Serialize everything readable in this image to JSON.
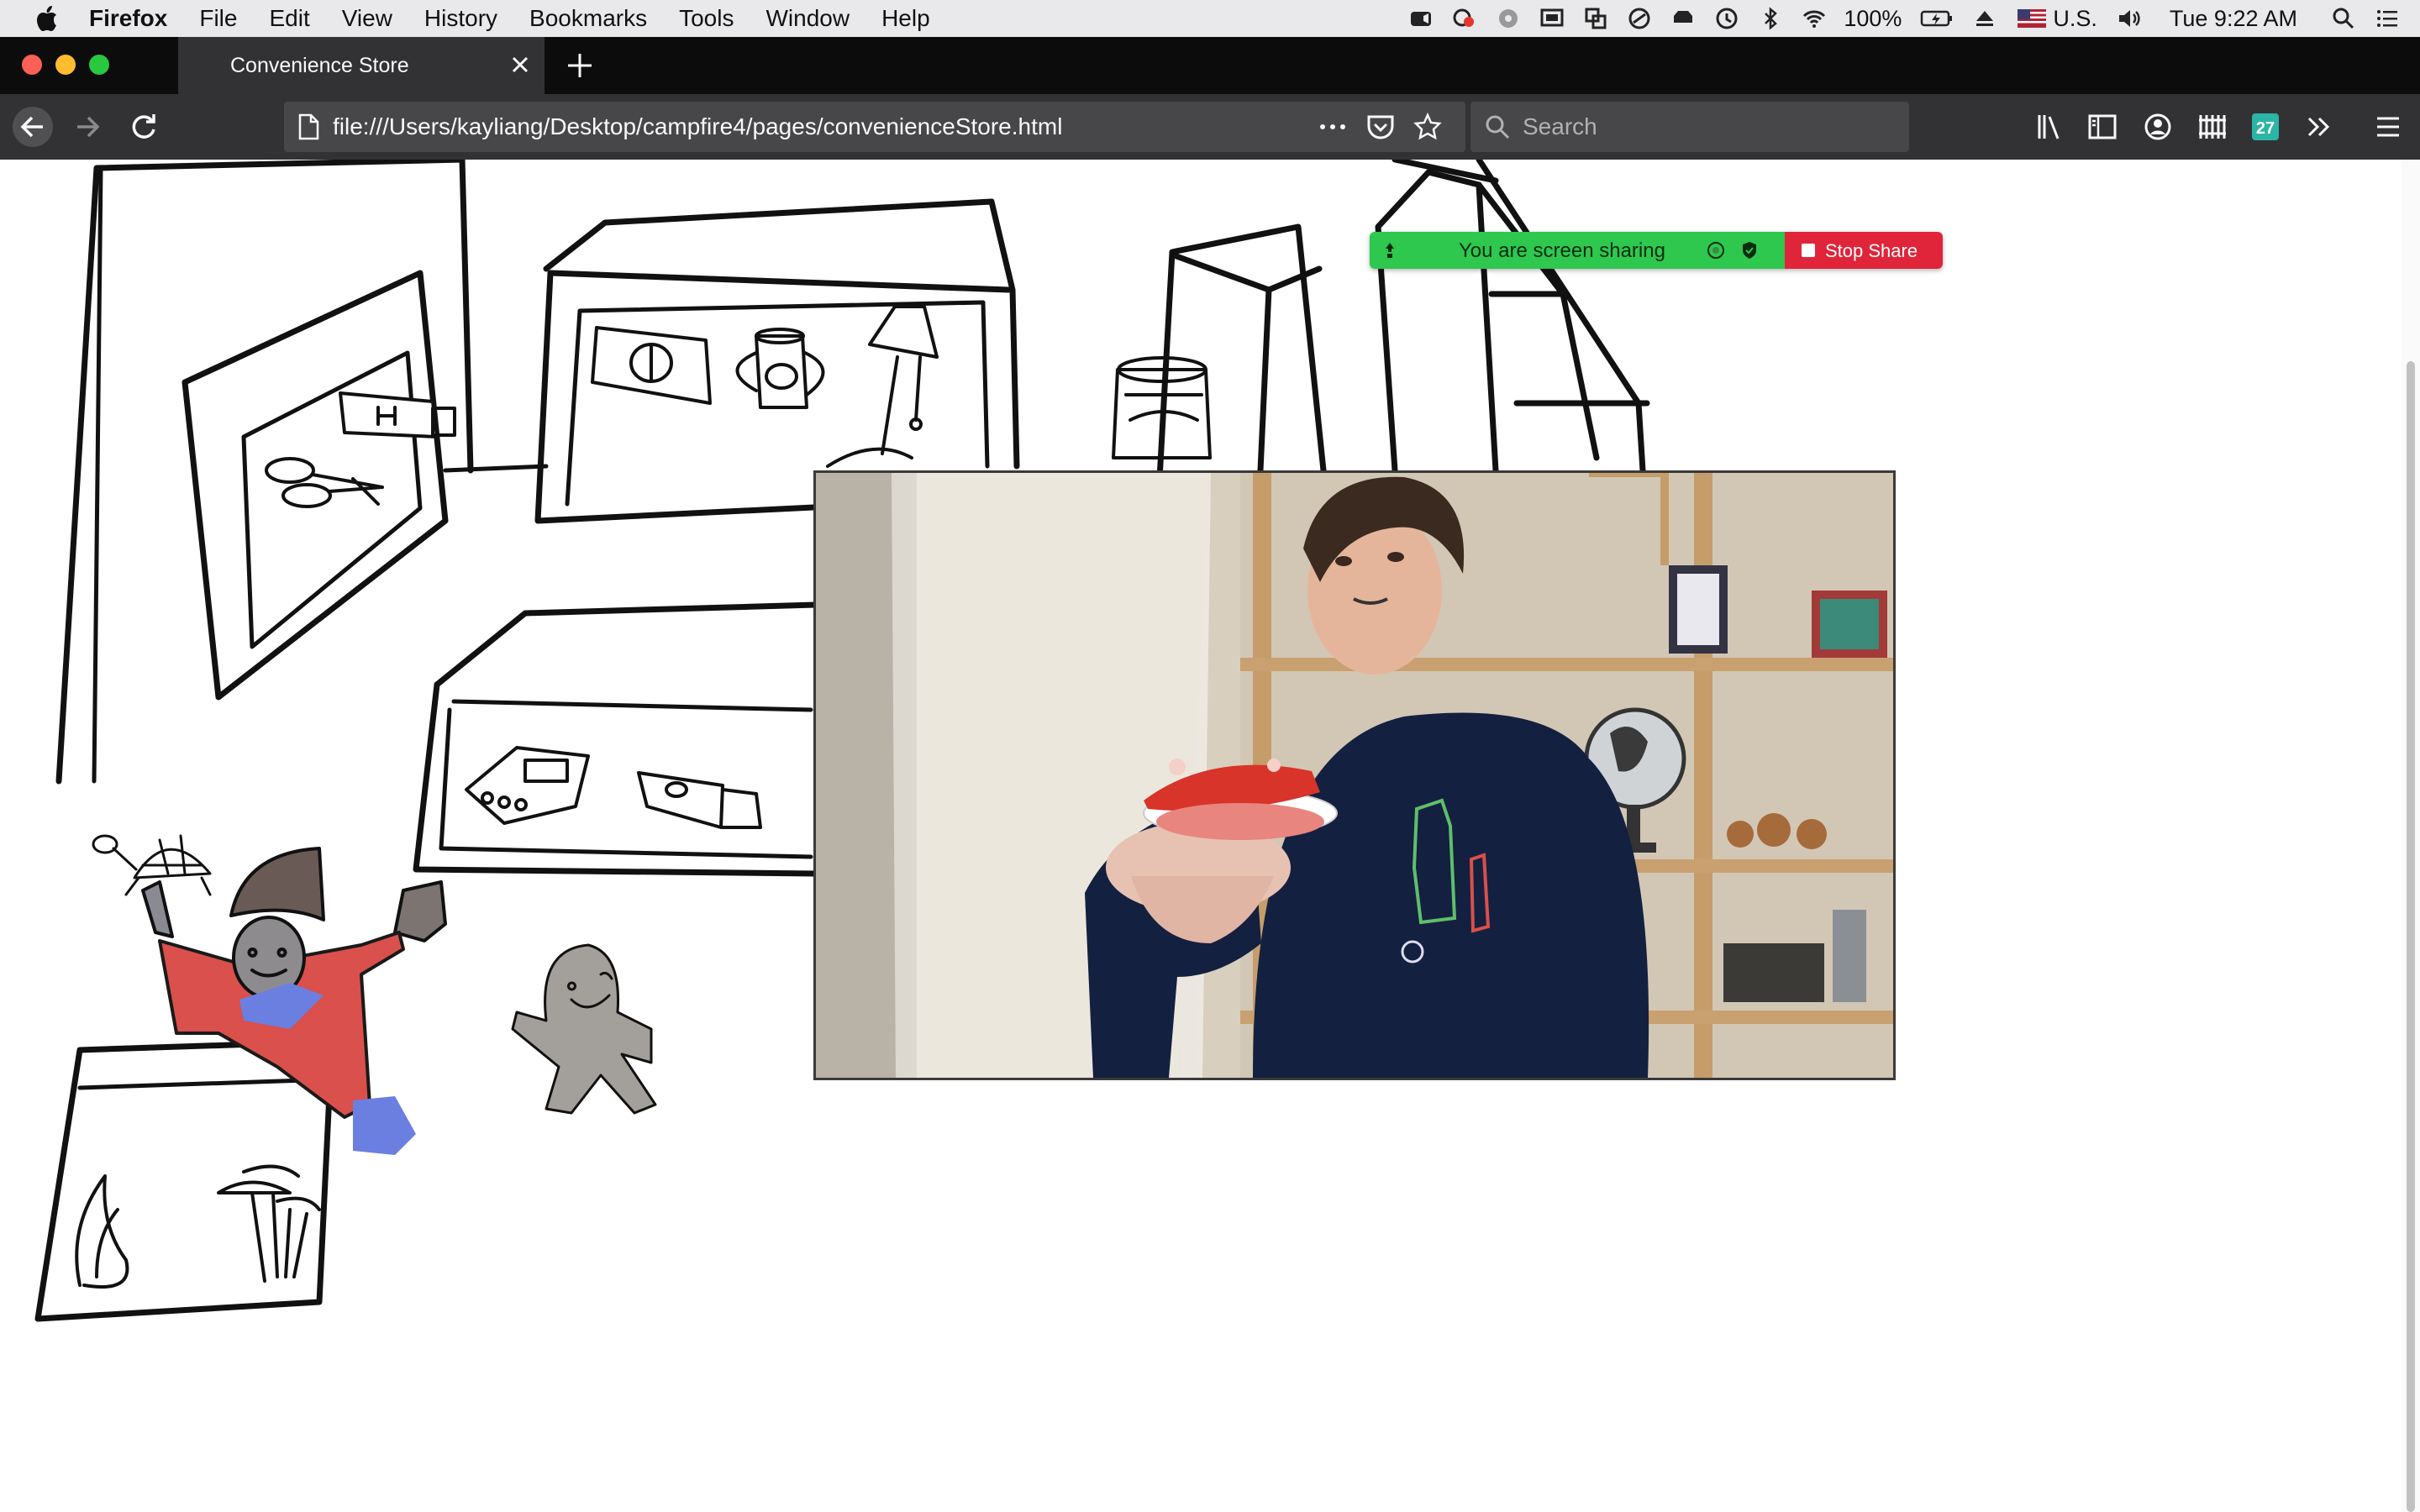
{
  "menubar": {
    "app_name": "Firefox",
    "items": [
      "File",
      "Edit",
      "View",
      "History",
      "Bookmarks",
      "Tools",
      "Window",
      "Help"
    ],
    "battery": "100%",
    "input_source": "U.S.",
    "clock": "Tue 9:22 AM"
  },
  "tabs": [
    {
      "title": "Convenience Store",
      "active": true
    }
  ],
  "toolbar": {
    "url": "file:///Users/kayliang/Desktop/campfire4/pages/convenienceStore.html",
    "search_placeholder": "Search",
    "badge_count": "27"
  },
  "share_banner": {
    "message": "You are screen sharing",
    "stop_label": "Stop Share"
  },
  "colors": {
    "tab_strip": "#0c0c0d",
    "toolbar": "#323234",
    "share_green": "#2dc84d",
    "share_red": "#e0243a",
    "traffic_close": "#fe5f57",
    "traffic_min": "#febc2e",
    "traffic_max": "#28c840"
  }
}
